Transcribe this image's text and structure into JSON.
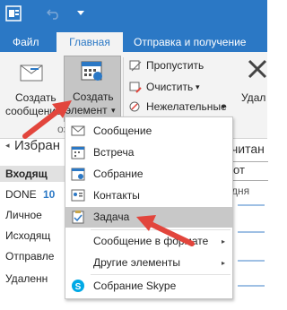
{
  "tabs": {
    "file": "Файл",
    "home": "Главная",
    "send_receive": "Отправка и получение"
  },
  "ribbon": {
    "new_email": {
      "line1": "Создать",
      "line2": "сообщение"
    },
    "new_items": {
      "line1": "Создать",
      "line2": "элемент",
      "arrow": "▾"
    },
    "ignore": "Пропустить",
    "clean_up": "Очистить",
    "junk": "Нежелательные",
    "delete_partial": "Удал",
    "partial_group": "озд"
  },
  "sidebar": {
    "heading": "Избран",
    "items": [
      "Входящ",
      "DONE",
      "Личное",
      "Исходящ",
      "Отправле",
      "Удаленн"
    ],
    "done_count": "10"
  },
  "right": {
    "unread": "читан",
    "col": "дня"
  },
  "menu": {
    "items": [
      {
        "label": "Сообщение",
        "icon": "envelope-icon"
      },
      {
        "label": "Встреча",
        "icon": "appointment-calendar-icon"
      },
      {
        "label": "Собрание",
        "icon": "meeting-icon"
      },
      {
        "label": "Контакты",
        "icon": "contact-card-icon"
      },
      {
        "label": "Задача",
        "icon": "task-clipboard-icon"
      },
      {
        "label": "Сообщение в формате",
        "icon": "",
        "submenu": "▸"
      },
      {
        "label": "Другие элементы",
        "icon": "",
        "submenu": "▸"
      },
      {
        "label": "Собрание Skype",
        "icon": "skype-icon"
      }
    ]
  },
  "colors": {
    "accent": "#2b78c5",
    "arrow": "#e2453c",
    "highlight": "#c8c8c8"
  }
}
